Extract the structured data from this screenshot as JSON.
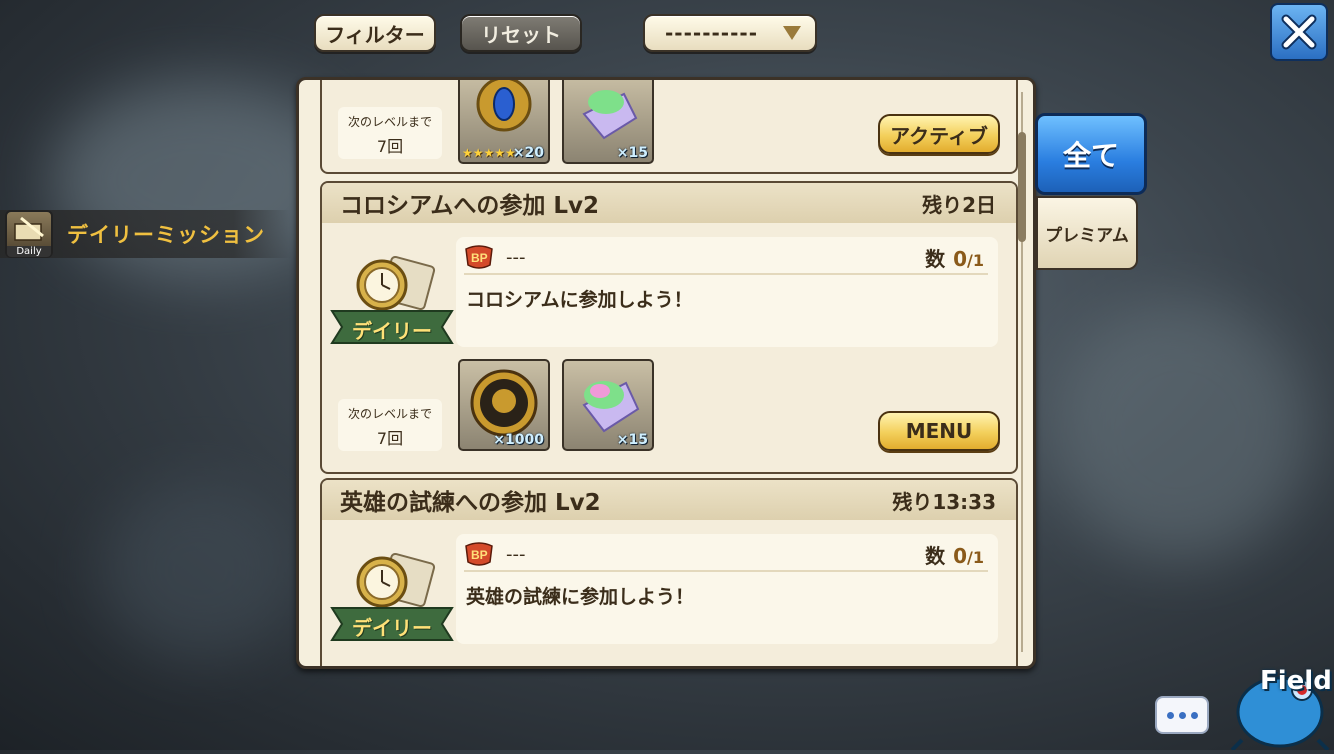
{
  "toolbar": {
    "filter_label": "フィルター",
    "reset_label": "リセット",
    "sort_value": "----------"
  },
  "sidebar": {
    "items": [
      {
        "label": "デイリーミッション",
        "icon_tag": "Daily",
        "icon": "book-quill-icon"
      }
    ]
  },
  "tabs": {
    "all": "全て",
    "premium": "プレミアム"
  },
  "missions": [
    {
      "next_level_label": "次のレベルまで",
      "next_level_times": "7回",
      "rewards": [
        {
          "icon": "crystal-medal-icon",
          "qty": "×20",
          "stars": "★★★★★"
        },
        {
          "icon": "rainbow-crystal-icon",
          "qty": "×15"
        }
      ],
      "action_label": "アクティブ"
    },
    {
      "title": "コロシアムへの参加 Lv2",
      "remaining": "残り2日",
      "badge": "デイリー",
      "bp_text": "---",
      "count_label": "数",
      "count_value": "0",
      "count_total": "/1",
      "description": "コロシアムに参加しよう！",
      "next_level_label": "次のレベルまで",
      "next_level_times": "7回",
      "rewards": [
        {
          "icon": "gold-coin-icon",
          "qty": "×1000"
        },
        {
          "icon": "rainbow-crystal-icon",
          "qty": "×15"
        }
      ],
      "action_label": "MENU"
    },
    {
      "title": "英雄の試練への参加 Lv2",
      "remaining": "残り13:33",
      "badge": "デイリー",
      "bp_text": "---",
      "count_label": "数",
      "count_value": "0",
      "count_total": "/1",
      "description": "英雄の試練に参加しよう！"
    }
  ],
  "footer": {
    "field_label": "Field"
  },
  "colors": {
    "accent_blue": "#2a7ee0",
    "gold_button": "#f3cf5b",
    "panel_bg": "#f5efdd",
    "sidebar_label": "#f0c040"
  }
}
